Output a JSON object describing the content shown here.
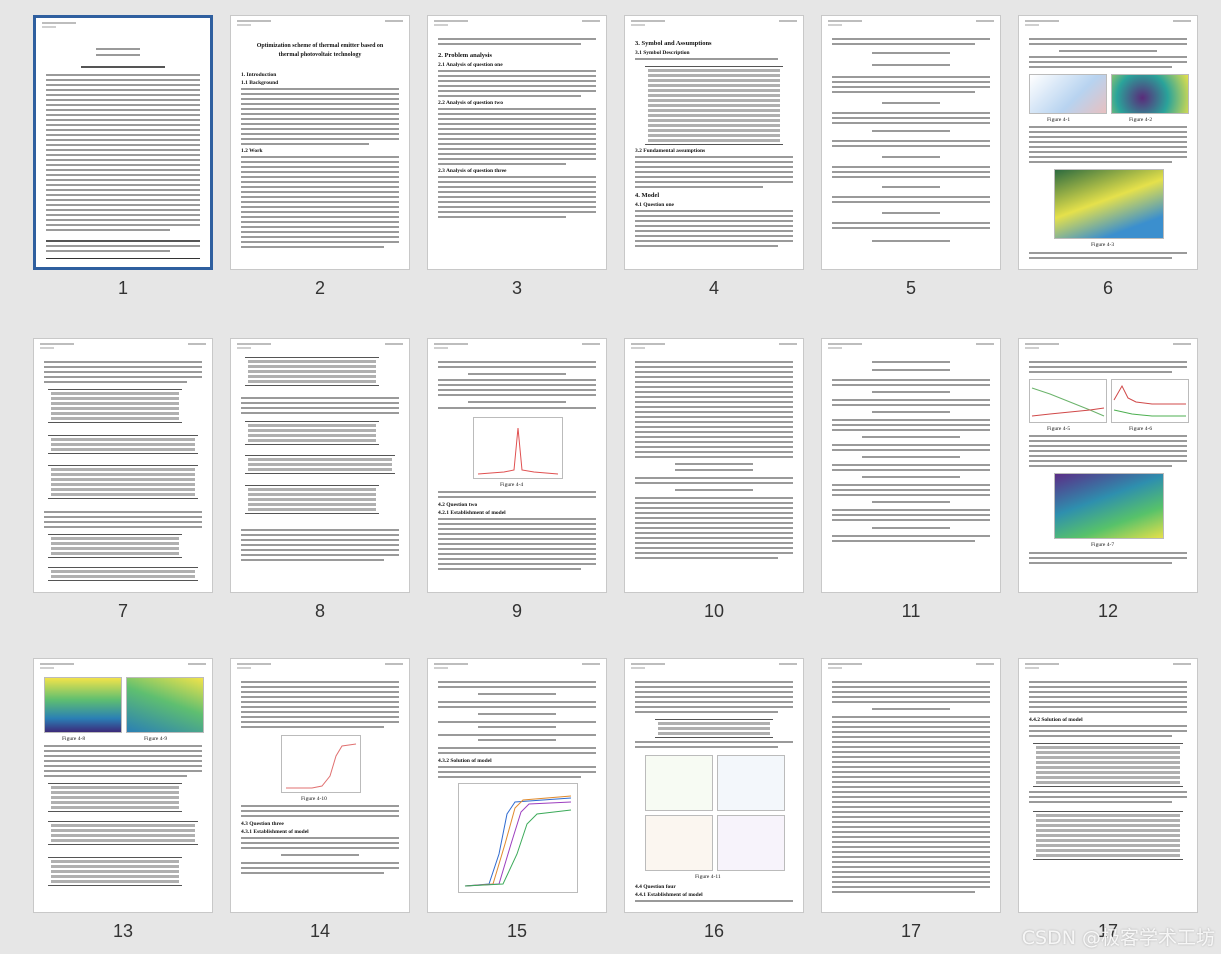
{
  "pages": [
    {
      "number": "1",
      "selected": true
    },
    {
      "number": "2",
      "title": "Optimization scheme of thermal emitter based on thermal photovoltaic technology",
      "headings": [
        "1. Introduction",
        "1.1 Background",
        "1.2 Work"
      ]
    },
    {
      "number": "3",
      "headings": [
        "2. Problem analysis",
        "2.1 Analysis of question one",
        "2.2 Analysis of question two",
        "2.3 Analysis of question three"
      ]
    },
    {
      "number": "4",
      "headings": [
        "3. Symbol and Assumptions",
        "3.1 Symbol Description",
        "3.2 Fundamental assumptions",
        "4. Model",
        "4.1 Question one"
      ]
    },
    {
      "number": "5",
      "figures": [
        "Figure 4-1",
        "Figure 4-2",
        "Figure 4-3"
      ]
    },
    {
      "number": "6"
    },
    {
      "number": "7"
    },
    {
      "number": "8",
      "figures": [
        "Figure 4-4"
      ],
      "headings": [
        "4.2 Question two",
        "4.2.1 Establishment of model"
      ]
    },
    {
      "number": "9"
    },
    {
      "number": "10"
    },
    {
      "number": "11",
      "figures": [
        "Figure 4-5",
        "Figure 4-6",
        "Figure 4-7"
      ]
    },
    {
      "number": "12",
      "figures": [
        "Figure 4-8",
        "Figure 4-9"
      ]
    },
    {
      "number": "13",
      "figures": [
        "Figure 4-10"
      ],
      "headings": [
        "4.3 Question three",
        "4.3.1 Establishment of model"
      ]
    },
    {
      "number": "14",
      "headings": [
        "4.3.2 Solution of model"
      ]
    },
    {
      "number": "15",
      "figures": [
        "Figure 4-11"
      ],
      "headings": [
        "4.4 Question four",
        "4.4.1 Establishment of model"
      ]
    },
    {
      "number": "16"
    },
    {
      "number": "17",
      "headings": [
        "4.4.2 Solution of model"
      ]
    }
  ],
  "watermark": "CSDN @极客学术工坊"
}
